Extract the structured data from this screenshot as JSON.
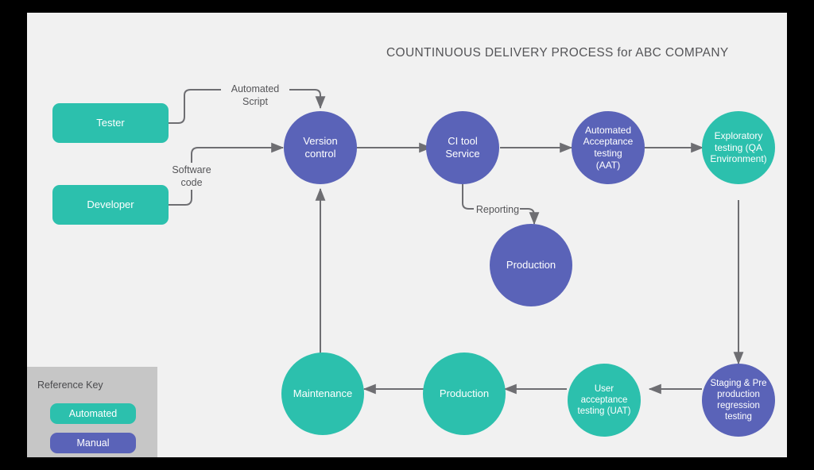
{
  "diagram": {
    "title": "COUNTINUOUS DELIVERY PROCESS for ABC COMPANY",
    "canvas_background": "#f1f1f1",
    "frame_color": "#000000",
    "edge_color": "#6e6e72",
    "colors": {
      "automated": "#2cc0ad",
      "manual": "#5a63b8",
      "text": "#ffffff",
      "label_text": "#555558",
      "legend_background": "#c6c6c6"
    }
  },
  "nodes": [
    {
      "id": "tester",
      "label": "Tester",
      "shape": "rounded-rect",
      "category": "Automated"
    },
    {
      "id": "developer",
      "label": "Developer",
      "shape": "rounded-rect",
      "category": "Automated"
    },
    {
      "id": "version",
      "label": "Version\ncontrol",
      "shape": "circle",
      "category": "Manual"
    },
    {
      "id": "ci",
      "label": "CI tool\nService",
      "shape": "circle",
      "category": "Manual"
    },
    {
      "id": "aat",
      "label": "Automated\nAcceptance\ntesting\n(AAT)",
      "shape": "circle",
      "category": "Manual"
    },
    {
      "id": "exploratory",
      "label": "Exploratory\ntesting (QA\nEnvironment)",
      "shape": "circle",
      "category": "Automated"
    },
    {
      "id": "production_top",
      "label": "Production",
      "shape": "circle",
      "category": "Manual"
    },
    {
      "id": "staging",
      "label": "Staging & Pre\nproduction\nregression\ntesting",
      "shape": "circle",
      "category": "Manual"
    },
    {
      "id": "uat",
      "label": "User\nacceptance\ntesting (UAT)",
      "shape": "circle",
      "category": "Automated"
    },
    {
      "id": "production_bottom",
      "label": "Production",
      "shape": "circle",
      "category": "Automated"
    },
    {
      "id": "maintenance",
      "label": "Maintenance",
      "shape": "circle",
      "category": "Automated"
    }
  ],
  "edges": [
    {
      "from": "tester",
      "to": "version",
      "label": "Automated\nScript"
    },
    {
      "from": "developer",
      "to": "version",
      "label": "Software\ncode"
    },
    {
      "from": "version",
      "to": "ci",
      "label": ""
    },
    {
      "from": "ci",
      "to": "aat",
      "label": ""
    },
    {
      "from": "aat",
      "to": "exploratory",
      "label": ""
    },
    {
      "from": "ci",
      "to": "production_top",
      "label": "Reporting"
    },
    {
      "from": "exploratory",
      "to": "staging",
      "label": ""
    },
    {
      "from": "staging",
      "to": "uat",
      "label": ""
    },
    {
      "from": "uat",
      "to": "production_bottom",
      "label": ""
    },
    {
      "from": "production_bottom",
      "to": "maintenance",
      "label": ""
    },
    {
      "from": "maintenance",
      "to": "version",
      "label": ""
    }
  ],
  "legend": {
    "title": "Reference Key",
    "items": [
      {
        "label": "Automated",
        "color": "#2cc0ad"
      },
      {
        "label": "Manual",
        "color": "#5a63b8"
      }
    ]
  }
}
